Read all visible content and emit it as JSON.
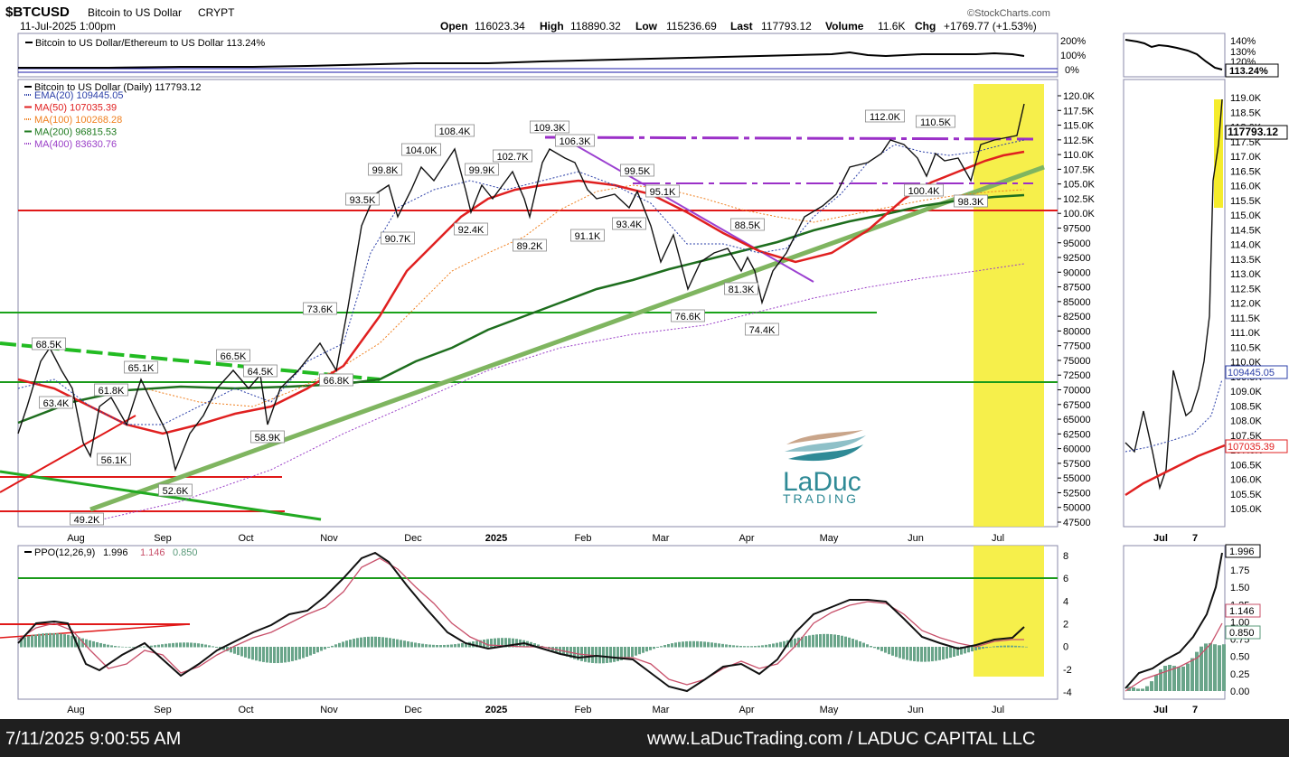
{
  "header": {
    "symbol": "$BTCUSD",
    "name": "Bitcoin to US Dollar",
    "exchange": "CRYPT",
    "date": "11-Jul-2025 1:00pm",
    "provider": "©StockCharts.com",
    "open_label": "Open",
    "open": "116023.34",
    "high_label": "High",
    "high": "118890.32",
    "low_label": "Low",
    "low": "115236.69",
    "last_label": "Last",
    "last": "117793.12",
    "volume_label": "Volume",
    "volume": "11.6K",
    "chg_label": "Chg",
    "chg": "+1769.77 (+1.53%)"
  },
  "ratio_panel": {
    "legend": "Bitcoin to US Dollar/Ethereum to US Dollar 113.24%",
    "ticks": [
      "200%",
      "100%",
      "0%"
    ],
    "right_ticks": [
      "140%",
      "130%",
      "120%"
    ],
    "right_badge": "113.24%"
  },
  "price_panel": {
    "legend_title": "Bitcoin to US Dollar (Daily) 117793.12",
    "legend": [
      {
        "label": "EMA(20) 109445.05",
        "color": "#2b3fa8",
        "style": "dot"
      },
      {
        "label": "MA(50) 107035.39",
        "color": "#e02020",
        "style": "solid"
      },
      {
        "label": "MA(100) 100268.28",
        "color": "#f08020",
        "style": "dot"
      },
      {
        "label": "MA(200) 96815.53",
        "color": "#1e7a1e",
        "style": "solid"
      },
      {
        "label": "MA(400) 83630.76",
        "color": "#9b40c8",
        "style": "dot"
      }
    ],
    "y_ticks": [
      "120.0K",
      "117.5K",
      "115.0K",
      "112.5K",
      "110.0K",
      "107.5K",
      "105.0K",
      "102.5K",
      "100.0K",
      "97500",
      "95000",
      "92500",
      "90000",
      "87500",
      "85000",
      "82500",
      "80000",
      "77500",
      "75000",
      "72500",
      "70000",
      "67500",
      "65000",
      "62500",
      "60000",
      "57500",
      "55000",
      "52500",
      "50000",
      "47500"
    ],
    "last_badge": "117793.12",
    "right_ticks": [
      "119.0K",
      "118.5K",
      "118.0K",
      "117.5K",
      "117.0K",
      "116.5K",
      "116.0K",
      "115.5K",
      "115.0K",
      "114.5K",
      "114.0K",
      "113.5K",
      "113.0K",
      "112.5K",
      "112.0K",
      "111.5K",
      "111.0K",
      "110.5K",
      "110.0K",
      "109.5K",
      "109.0K",
      "108.5K",
      "108.0K",
      "107.5K",
      "107.0K",
      "106.5K",
      "106.0K",
      "105.5K",
      "105.0K"
    ],
    "right_badge_ema": "109445.05",
    "right_badge_ma50": "107035.39",
    "annotations": [
      {
        "text": "68.5K",
        "x": 54,
        "y": 381
      },
      {
        "text": "63.4K",
        "x": 62,
        "y": 446
      },
      {
        "text": "61.8K",
        "x": 123,
        "y": 432
      },
      {
        "text": "65.1K",
        "x": 156,
        "y": 407
      },
      {
        "text": "56.1K",
        "x": 126,
        "y": 509
      },
      {
        "text": "52.6K",
        "x": 194,
        "y": 543
      },
      {
        "text": "49.2K",
        "x": 96,
        "y": 575
      },
      {
        "text": "66.5K",
        "x": 258,
        "y": 394
      },
      {
        "text": "64.5K",
        "x": 288,
        "y": 411
      },
      {
        "text": "58.9K",
        "x": 296,
        "y": 484
      },
      {
        "text": "73.6K",
        "x": 354,
        "y": 342
      },
      {
        "text": "66.8K",
        "x": 372,
        "y": 421
      },
      {
        "text": "93.5K",
        "x": 401,
        "y": 221
      },
      {
        "text": "90.7K",
        "x": 440,
        "y": 264
      },
      {
        "text": "99.8K",
        "x": 426,
        "y": 188
      },
      {
        "text": "104.0K",
        "x": 466,
        "y": 166
      },
      {
        "text": "108.4K",
        "x": 503,
        "y": 145
      },
      {
        "text": "92.4K",
        "x": 521,
        "y": 254
      },
      {
        "text": "99.9K",
        "x": 533,
        "y": 188
      },
      {
        "text": "102.7K",
        "x": 567,
        "y": 173
      },
      {
        "text": "89.2K",
        "x": 586,
        "y": 272
      },
      {
        "text": "109.3K",
        "x": 608,
        "y": 141
      },
      {
        "text": "106.3K",
        "x": 636,
        "y": 156
      },
      {
        "text": "91.1K",
        "x": 650,
        "y": 261
      },
      {
        "text": "99.5K",
        "x": 705,
        "y": 189
      },
      {
        "text": "95.1K",
        "x": 733,
        "y": 212
      },
      {
        "text": "93.4K",
        "x": 696,
        "y": 248
      },
      {
        "text": "88.5K",
        "x": 827,
        "y": 249
      },
      {
        "text": "81.3K",
        "x": 820,
        "y": 320
      },
      {
        "text": "76.6K",
        "x": 761,
        "y": 350
      },
      {
        "text": "74.4K",
        "x": 843,
        "y": 365
      },
      {
        "text": "112.0K",
        "x": 979,
        "y": 129
      },
      {
        "text": "110.5K",
        "x": 1035,
        "y": 135
      },
      {
        "text": "100.4K",
        "x": 1022,
        "y": 211
      },
      {
        "text": "98.3K",
        "x": 1074,
        "y": 223
      }
    ],
    "logo_name": "LaDuc",
    "logo_sub": "TRADING"
  },
  "x_axis": {
    "labels": [
      {
        "text": "Aug",
        "x": 84
      },
      {
        "text": "Sep",
        "x": 180
      },
      {
        "text": "Oct",
        "x": 272
      },
      {
        "text": "Nov",
        "x": 364
      },
      {
        "text": "Dec",
        "x": 457
      },
      {
        "text": "2025",
        "x": 549
      },
      {
        "text": "Feb",
        "x": 645
      },
      {
        "text": "Mar",
        "x": 731
      },
      {
        "text": "Apr",
        "x": 826
      },
      {
        "text": "May",
        "x": 917
      },
      {
        "text": "Jun",
        "x": 1013
      },
      {
        "text": "Jul",
        "x": 1104
      }
    ],
    "right_labels": [
      {
        "text": "Jul",
        "x": 1284
      },
      {
        "text": "7",
        "x": 1322
      }
    ]
  },
  "ppo_panel": {
    "legend_name": "PPO(12,26,9)",
    "legend_ppo": "1.996",
    "legend_signal": "1.146",
    "legend_hist": "0.850",
    "y_ticks": [
      "8",
      "6",
      "4",
      "2",
      "0",
      "-2",
      "-4"
    ],
    "right_ticks": [
      "1.75",
      "1.50",
      "1.25",
      "1.00",
      "0.75",
      "0.50",
      "0.25",
      "0.00"
    ],
    "badges": [
      "1.996",
      "1.146",
      "0.850"
    ]
  },
  "footer": {
    "timestamp": "7/11/2025 9:00:55 AM",
    "site": "www.LaDucTrading.com / LADUC CAPITAL LLC"
  },
  "chart_data": {
    "type": "line",
    "title": "Bitcoin to US Dollar (Daily)",
    "x": [
      "Aug",
      "Sep",
      "Oct",
      "Nov",
      "Dec",
      "2025",
      "Feb",
      "Mar",
      "Apr",
      "May",
      "Jun",
      "Jul"
    ],
    "series": [
      {
        "name": "Bitcoin to US Dollar (Daily)",
        "values": [
          63400,
          58900,
          64000,
          70000,
          99000,
          95000,
          102000,
          85000,
          81000,
          95000,
          107000,
          117793
        ]
      },
      {
        "name": "EMA(20)",
        "values": [
          62000,
          59000,
          62000,
          68000,
          95000,
          98000,
          101000,
          90000,
          84000,
          92000,
          105000,
          109445
        ]
      },
      {
        "name": "MA(50)",
        "values": [
          62000,
          59000,
          60000,
          64000,
          85000,
          96000,
          99000,
          94000,
          86000,
          88000,
          100000,
          107035
        ]
      },
      {
        "name": "MA(200)",
        "values": [
          58000,
          60000,
          62000,
          64000,
          68000,
          74000,
          80000,
          84000,
          85000,
          89000,
          93000,
          96815
        ]
      },
      {
        "name": "MA(400)",
        "values": [
          47000,
          50000,
          53000,
          56000,
          60000,
          64000,
          68000,
          72000,
          75000,
          78000,
          81000,
          83630
        ]
      }
    ],
    "ylim": [
      47500,
      120000
    ],
    "grid": false,
    "legend": "top-left"
  }
}
